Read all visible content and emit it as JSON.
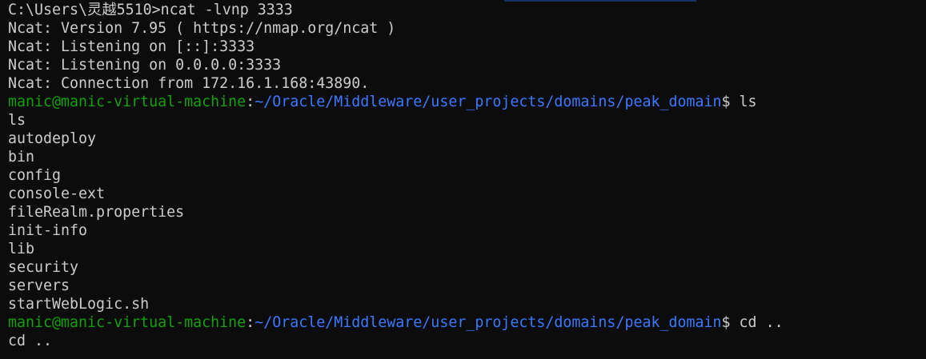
{
  "terminal": {
    "colors": {
      "background": "#0c0c0c",
      "text": "#cccccc",
      "user": "#13a10e",
      "path": "#3b78ff"
    },
    "lines": [
      "C:\\Users\\灵越5510>ncat -lvnp 3333",
      "Ncat: Version 7.95 ( https://nmap.org/ncat )",
      "Ncat: Listening on [::]:3333",
      "Ncat: Listening on 0.0.0.0:3333",
      "Ncat: Connection from 172.16.1.168:43890."
    ],
    "prompt1": {
      "user": "manic@manic-virtual-machine",
      "sep": ":",
      "path": "~/Oracle/Middleware/user_projects/domains/peak_domain",
      "symbol": "$ ",
      "command": "ls"
    },
    "output1": [
      "ls",
      "autodeploy",
      "bin",
      "config",
      "console-ext",
      "fileRealm.properties",
      "init-info",
      "lib",
      "security",
      "servers",
      "startWebLogic.sh"
    ],
    "prompt2": {
      "user": "manic@manic-virtual-machine",
      "sep": ":",
      "path": "~/Oracle/Middleware/user_projects/domains/peak_domain",
      "symbol": "$ ",
      "command": "cd .."
    },
    "output2": [
      "cd .."
    ]
  }
}
